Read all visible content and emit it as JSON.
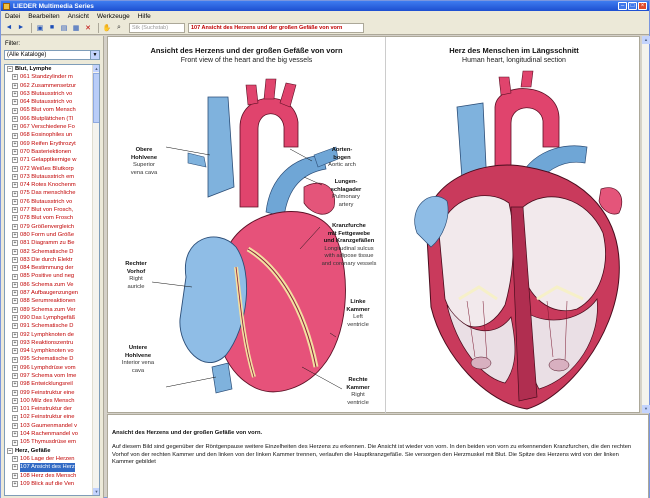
{
  "window": {
    "title": "LIEDER Multimedia Series"
  },
  "menu": [
    "Datei",
    "Bearbeiten",
    "Ansicht",
    "Werkzeuge",
    "Hilfe"
  ],
  "toolbar": {
    "field_search": "Stk (Suchstab)",
    "field_current": "107 Ansicht des Herzens und der großen Gefäße von vorn"
  },
  "left": {
    "filter_label": "Filter:",
    "filter_value": "(Alle Kataloge)",
    "tree": [
      {
        "type": "cat",
        "label": "Blut, Lymphe"
      },
      {
        "type": "item",
        "label": "061 Standzylinder m"
      },
      {
        "type": "item",
        "label": "062 Zusammensetzur"
      },
      {
        "type": "item",
        "label": "063 Blutausstrich vo"
      },
      {
        "type": "item",
        "label": "064 Blutausstrich vo"
      },
      {
        "type": "item",
        "label": "065 Blut vom Mensch"
      },
      {
        "type": "item",
        "label": "066 Blutplättchen (Tl"
      },
      {
        "type": "item",
        "label": "067 Verschiedene Fo"
      },
      {
        "type": "item",
        "label": "068 Eosinophiles un"
      },
      {
        "type": "item",
        "label": "069 Reifen Erythrozyt"
      },
      {
        "type": "item",
        "label": "070 Basteriektionen"
      },
      {
        "type": "item",
        "label": "071 Gelapptkernige w"
      },
      {
        "type": "item",
        "label": "072 Weißes Blutkorp"
      },
      {
        "type": "item",
        "label": "073 Blutausstrich em"
      },
      {
        "type": "item",
        "label": "074 Rotes Knochenm"
      },
      {
        "type": "item",
        "label": "075 Das menschliche"
      },
      {
        "type": "item",
        "label": "076 Blutausstrich vo"
      },
      {
        "type": "item",
        "label": "077 Blut von Frosch,"
      },
      {
        "type": "item",
        "label": "078 Blut vom Frosch"
      },
      {
        "type": "item",
        "label": "079 Größenvergleich"
      },
      {
        "type": "item",
        "label": "080 Form und Größe"
      },
      {
        "type": "item",
        "label": "081 Diagramm zu Be"
      },
      {
        "type": "item",
        "label": "082 Schematische D"
      },
      {
        "type": "item",
        "label": "083 Die durch Elektr"
      },
      {
        "type": "item",
        "label": "084 Bestimmung der"
      },
      {
        "type": "item",
        "label": "085 Positive und neg"
      },
      {
        "type": "item",
        "label": "086 Schema zum Ve"
      },
      {
        "type": "item",
        "label": "087 Aufbaugenzungen"
      },
      {
        "type": "item",
        "label": "088 Serumreaktionen"
      },
      {
        "type": "item",
        "label": "089 Schema zum Ver"
      },
      {
        "type": "item",
        "label": "090 Das Lymphgefäß"
      },
      {
        "type": "item",
        "label": "091 Schematische D"
      },
      {
        "type": "item",
        "label": "092 Lymphknoten de"
      },
      {
        "type": "item",
        "label": "093 Reaktionszentru"
      },
      {
        "type": "item",
        "label": "094 Lymphknoten vo"
      },
      {
        "type": "item",
        "label": "095 Schematische D"
      },
      {
        "type": "item",
        "label": "096 Lymphdrüse vom"
      },
      {
        "type": "item",
        "label": "097 Schema vom Ime"
      },
      {
        "type": "item",
        "label": "098 Entwicklungsreil"
      },
      {
        "type": "item",
        "label": "099 Feinstruktur eine"
      },
      {
        "type": "item",
        "label": "100 Milz des Mensch"
      },
      {
        "type": "item",
        "label": "101 Feinstruktur der"
      },
      {
        "type": "item",
        "label": "102 Feinstruktur eine"
      },
      {
        "type": "item",
        "label": "103 Gaumenmandel v"
      },
      {
        "type": "item",
        "label": "104 Rachenmandel vo"
      },
      {
        "type": "item",
        "label": "105 Thymusdrüse em"
      },
      {
        "type": "cat",
        "label": "Herz, Gefäße"
      },
      {
        "type": "item",
        "label": "106 Lage der Herzen"
      },
      {
        "type": "item",
        "label": "107 Ansicht des Herz",
        "selected": true
      },
      {
        "type": "item",
        "label": "108 Herz des Mensch"
      },
      {
        "type": "item",
        "label": "109 Blick auf die Ven"
      }
    ]
  },
  "panel1": {
    "title": "Ansicht des Herzens und der großen Gefäße von vorn",
    "subtitle": "Front view of the heart and the big vessels",
    "labels": {
      "obere_de1": "Obere",
      "obere_de2": "Hohlvene",
      "obere_en1": "Superior",
      "obere_en2": "vena cava",
      "aorten_de1": "Aorten-",
      "aorten_de2": "bogen",
      "aorten_en": "Aortic arch",
      "lungen_de1": "Lungen-",
      "lungen_de2": "schlagader",
      "lungen_en1": "Pulmonary",
      "lungen_en2": "artery",
      "kranz_de1": "Kranzfurche",
      "kranz_de2": "mit Fettgewebe",
      "kranz_de3": "und Kranzgefäßen",
      "kranz_en1": "Longitudinal sulcus",
      "kranz_en2": "with adipose tissue",
      "kranz_en3": "and coronary vessels",
      "rv_de1": "Rechter",
      "rv_de2": "Vorhof",
      "rv_en1": "Right",
      "rv_en2": "auricle",
      "lk_de1": "Linke",
      "lk_de2": "Kammer",
      "lk_en1": "Left",
      "lk_en2": "ventricle",
      "uh_de1": "Untere",
      "uh_de2": "Hohlvene",
      "uh_en1": "Interior vena",
      "uh_en2": "cava",
      "rk_de1": "Rechte",
      "rk_de2": "Kammer",
      "rk_en1": "Right",
      "rk_en2": "ventricle"
    }
  },
  "panel2": {
    "title": "Herz des Menschen im Längsschnitt",
    "subtitle": "Human heart, longitudinal section"
  },
  "text": {
    "title": "Ansicht des Herzens und der großen Gefäße von vorn.",
    "body": "Auf diesem Bild sind gegenüber der Röntgenpause weitere Einzelheiten des Herzens zu erkennen. Die Ansicht ist wieder von vorn. In den beiden von vorn zu erkennenden Kranzfurchen, die den rechten Vorhof von der rechten Kammer und den linken von der linken Kammer trennen, verlaufen die Hauptkranzgefäße. Sie versorgen den Herzmuskel mit Blut. Die Spitze des Herzens wird von der linken Kammer gebildet"
  }
}
